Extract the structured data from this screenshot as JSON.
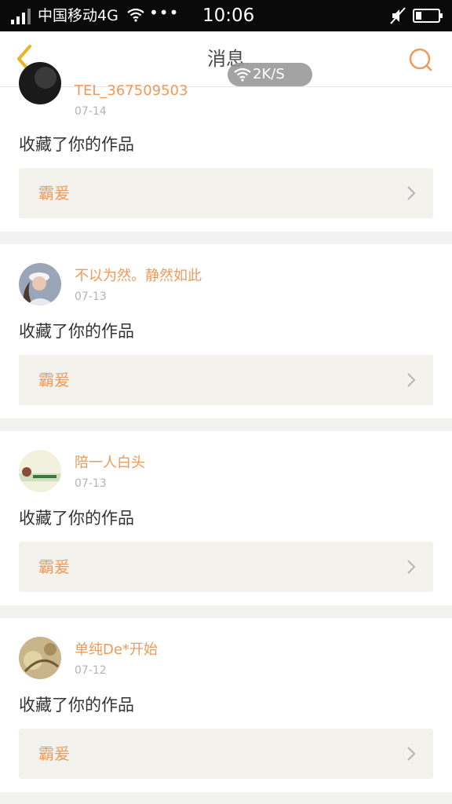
{
  "status_bar": {
    "carrier": "中国移动4G",
    "dots": "•••",
    "time": "10:06"
  },
  "header": {
    "title": "消息",
    "speed": "2K/S"
  },
  "colors": {
    "accent": "#ee9a5b",
    "back_arrow": "#e8b52a"
  },
  "messages": [
    {
      "username": "TEL_367509503",
      "date": "07-14",
      "action": "收藏了你的作品",
      "work": "霸爰",
      "avatar": "dark-avatar"
    },
    {
      "username": "不以为然。静然如此",
      "date": "07-13",
      "action": "收藏了你的作品",
      "work": "霸爰",
      "avatar": "girl-cap-avatar"
    },
    {
      "username": "陪一人白头",
      "date": "07-13",
      "action": "收藏了你的作品",
      "work": "霸爰",
      "avatar": "flower-text-avatar"
    },
    {
      "username": "单纯De*开始",
      "date": "07-12",
      "action": "收藏了你的作品",
      "work": "霸爰",
      "avatar": "sepia-avatar"
    }
  ]
}
